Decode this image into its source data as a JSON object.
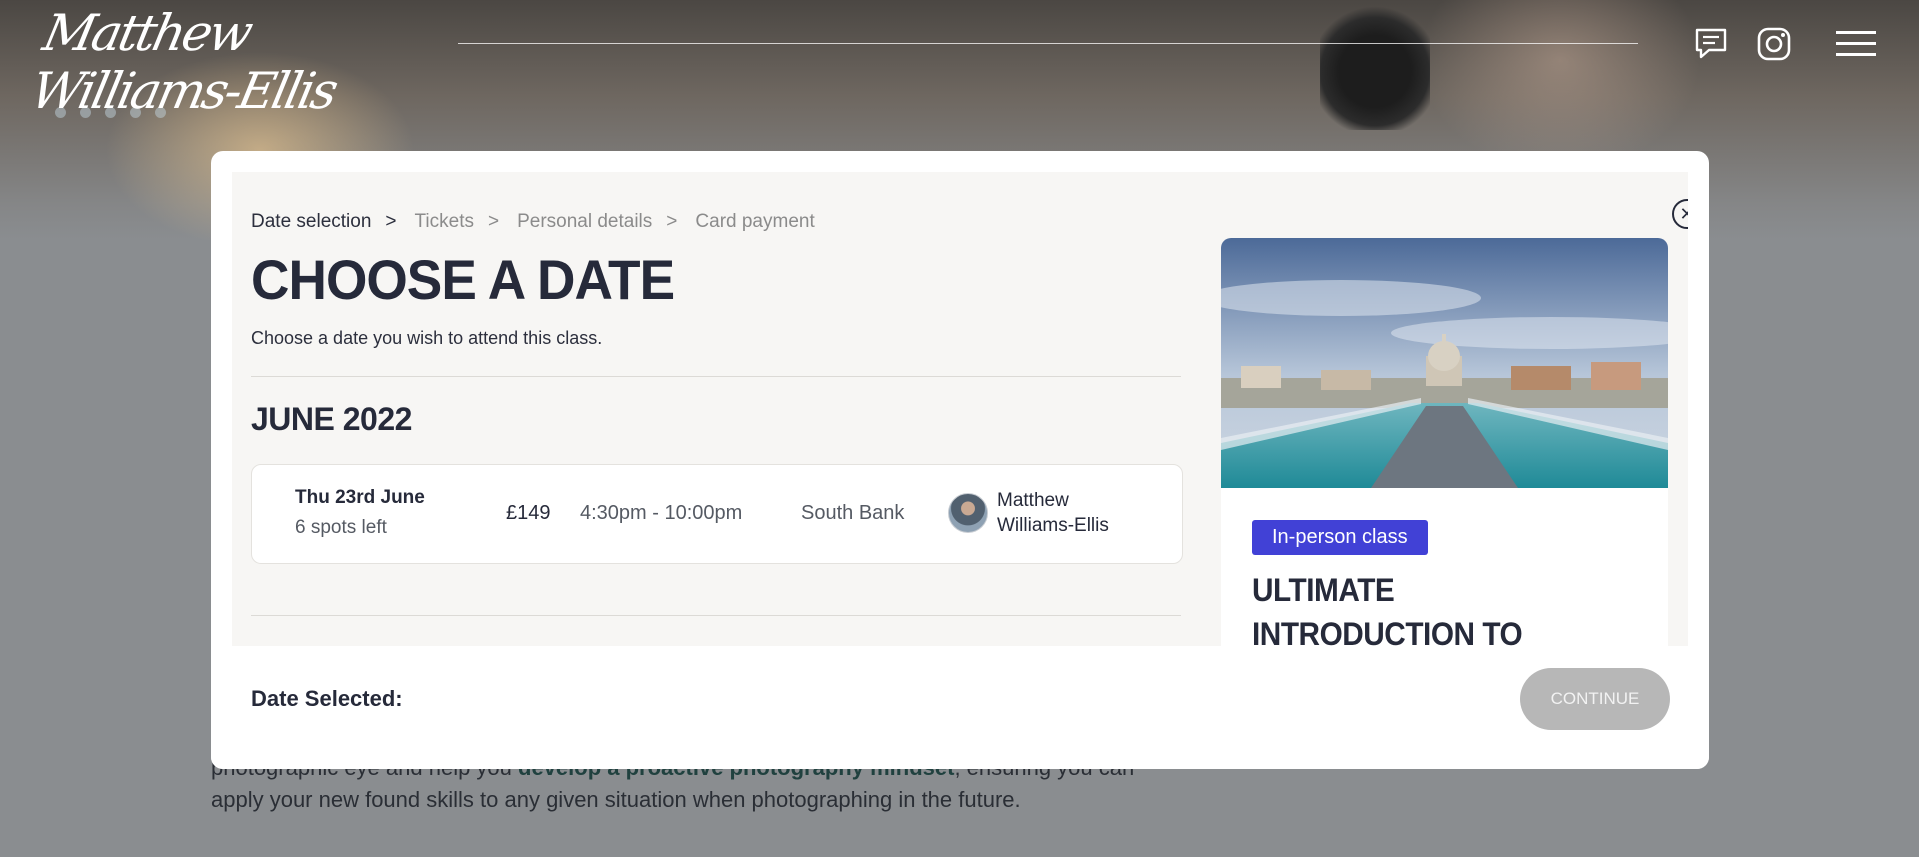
{
  "header": {
    "logo_text": "Matthew Williams-Ellis",
    "icons": [
      "chat-icon",
      "instagram-icon",
      "menu-icon"
    ]
  },
  "background": {
    "text_before": "photographic eye and help you ",
    "text_bold": "develop a proactive photography mindset",
    "text_after": ", ensuring you can apply your new found skills to any given situation when photographing in the future."
  },
  "modal": {
    "breadcrumb": [
      "Date selection",
      "Tickets",
      "Personal details",
      "Card payment"
    ],
    "breadcrumb_separator": ">",
    "title": "CHOOSE A DATE",
    "subtitle": "Choose a date you wish to attend this class.",
    "month": "JUNE 2022",
    "session": {
      "date": "Thu 23rd June",
      "spots": "6 spots left",
      "price": "£149",
      "time": "4:30pm - 10:00pm",
      "location": "South Bank",
      "tutor": "Matthew Williams-Ellis"
    },
    "class_card": {
      "badge": "In-person class",
      "title": "ULTIMATE INTRODUCTION TO PHOTOGRAPHY: SOUTH"
    },
    "footer": {
      "date_selected_label": "Date Selected:",
      "continue_label": "CONTINUE"
    },
    "colors": {
      "badge": "#4141d6",
      "heading": "#262a3a",
      "continue_disabled": "#b7b7b7"
    }
  }
}
